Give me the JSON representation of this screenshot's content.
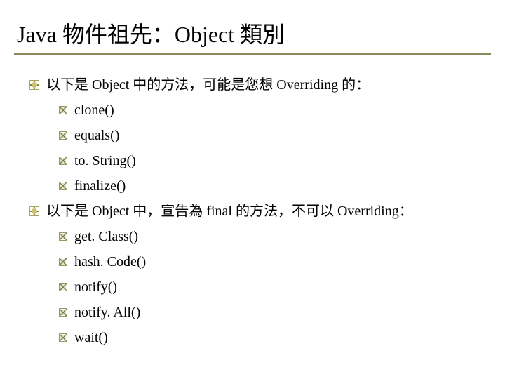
{
  "title": "Java 物件祖先：Object 類別",
  "sections": [
    {
      "heading": "以下是 Object 中的方法，可能是您想 Overriding 的：",
      "items": [
        "clone()",
        "equals()",
        "to. String()",
        "finalize()"
      ]
    },
    {
      "heading": "以下是 Object 中，宣告為 final 的方法，不可以 Overriding：",
      "items": [
        "get. Class()",
        "hash. Code()",
        "notify()",
        "notify. All()",
        "wait()"
      ]
    }
  ]
}
